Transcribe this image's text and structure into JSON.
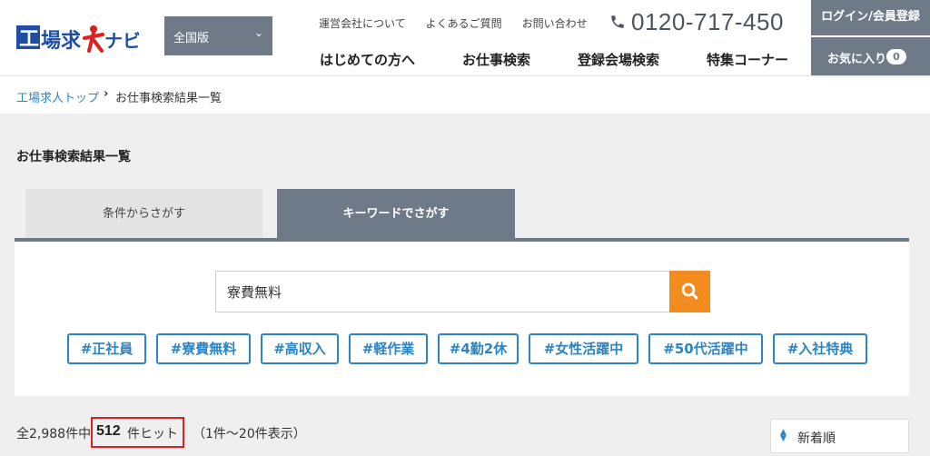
{
  "header": {
    "logo_text": "工場求人ナビ",
    "region_select": "全国版",
    "top_links": [
      "運営会社について",
      "よくあるご質問",
      "お問い合わせ"
    ],
    "phone": "0120-717-450",
    "nav": [
      "はじめての方へ",
      "お仕事検索",
      "登録会場検索",
      "特集コーナー"
    ],
    "login_label": "ログイン/会員登録",
    "favorites_label": "お気に入り",
    "favorites_count": "0"
  },
  "breadcrumb": {
    "home": "工場求人トップ",
    "separator": "›",
    "current": "お仕事検索結果一覧"
  },
  "page_title": "お仕事検索結果一覧",
  "tabs": [
    {
      "label": "条件からさがす",
      "active": false
    },
    {
      "label": "キーワードでさがす",
      "active": true
    }
  ],
  "search": {
    "value": "寮費無料",
    "icon": "search-icon"
  },
  "tags": [
    "#正社員",
    "#寮費無料",
    "#高収入",
    "#軽作業",
    "#4勤2休",
    "#女性活躍中",
    "#50代活躍中",
    "#入社特典"
  ],
  "results": {
    "total_text": "全2,988件中",
    "hit_count": "512",
    "hit_label": "件ヒット",
    "range_text": "（1件〜20件表示）"
  },
  "sort": {
    "label": "新着順",
    "icon": "sort-icon"
  },
  "colors": {
    "accent_gray": "#6e7a88",
    "link_blue": "#2b84c6",
    "search_orange": "#f28c1e",
    "highlight_red": "#e02020"
  }
}
